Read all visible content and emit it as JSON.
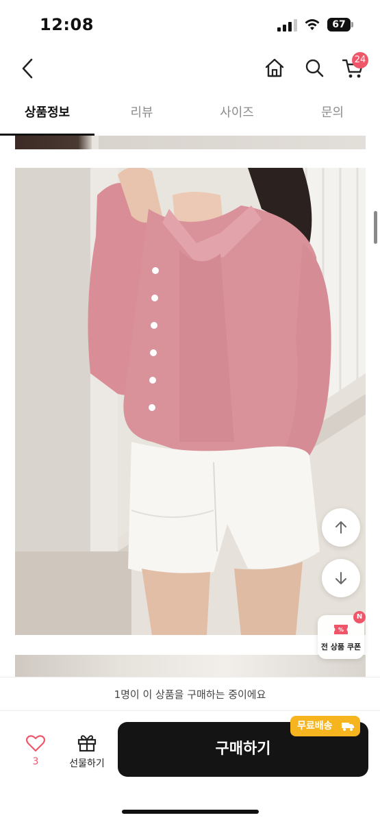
{
  "status_bar": {
    "time": "12:08",
    "battery": "67"
  },
  "header": {
    "back_icon": "chevron-left-icon",
    "home_icon": "home-icon",
    "search_icon": "search-icon",
    "cart_icon": "cart-icon",
    "cart_count": "24"
  },
  "tabs": [
    {
      "label": "상품정보",
      "active": true
    },
    {
      "label": "리뷰",
      "active": false
    },
    {
      "label": "사이즈",
      "active": false
    },
    {
      "label": "문의",
      "active": false
    }
  ],
  "floating": {
    "scroll_up_icon": "arrow-up-icon",
    "scroll_down_icon": "arrow-down-icon",
    "coupon_label": "전 상품 쿠폰",
    "coupon_badge": "N"
  },
  "buying_notice": "1명이 이 상품을 구매하는 중이에요",
  "bottom_bar": {
    "like_icon": "heart-icon",
    "like_count": "3",
    "gift_icon": "gift-icon",
    "gift_label": "선물하기",
    "buy_label": "구매하기",
    "shipping_badge": "무료배송"
  },
  "colors": {
    "accent_pink": "#f0566a",
    "shipping_yellow": "#f6b41f",
    "buy_button": "#141414"
  }
}
